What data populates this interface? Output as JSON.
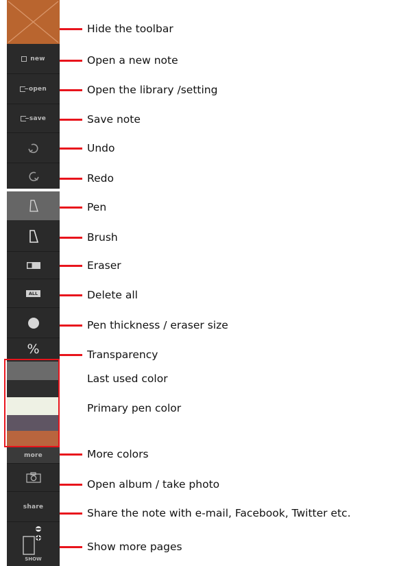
{
  "colors": {
    "toolbar_bg": "#2a2a2a",
    "hide_button_bg": "#b9652f",
    "leader_line": "#e8141c",
    "swatch_last_used": "#6b6b6b",
    "swatch_dark": "#2e2e2e",
    "swatch_primary": "#eef1e4",
    "swatch_purple": "#5f5563",
    "swatch_orange": "#b9653e"
  },
  "toolbar": {
    "new_label": "new",
    "open_label": "open",
    "save_label": "save",
    "delete_all_label": "ALL",
    "transparency_symbol": "%",
    "more_label": "more",
    "share_label": "share",
    "show_label": "SHOW"
  },
  "annotations": [
    "Hide the toolbar",
    "Open a new note",
    "Open the library /setting",
    "Save note",
    "Undo",
    "Redo",
    "Pen",
    "Brush",
    "Eraser",
    "Delete all",
    "Pen thickness / eraser size",
    "Transparency",
    "Last used color",
    "Primary pen color",
    "More colors",
    "Open album / take photo",
    "Share the note with e-mail, Facebook, Twitter etc.",
    "Show more pages"
  ]
}
